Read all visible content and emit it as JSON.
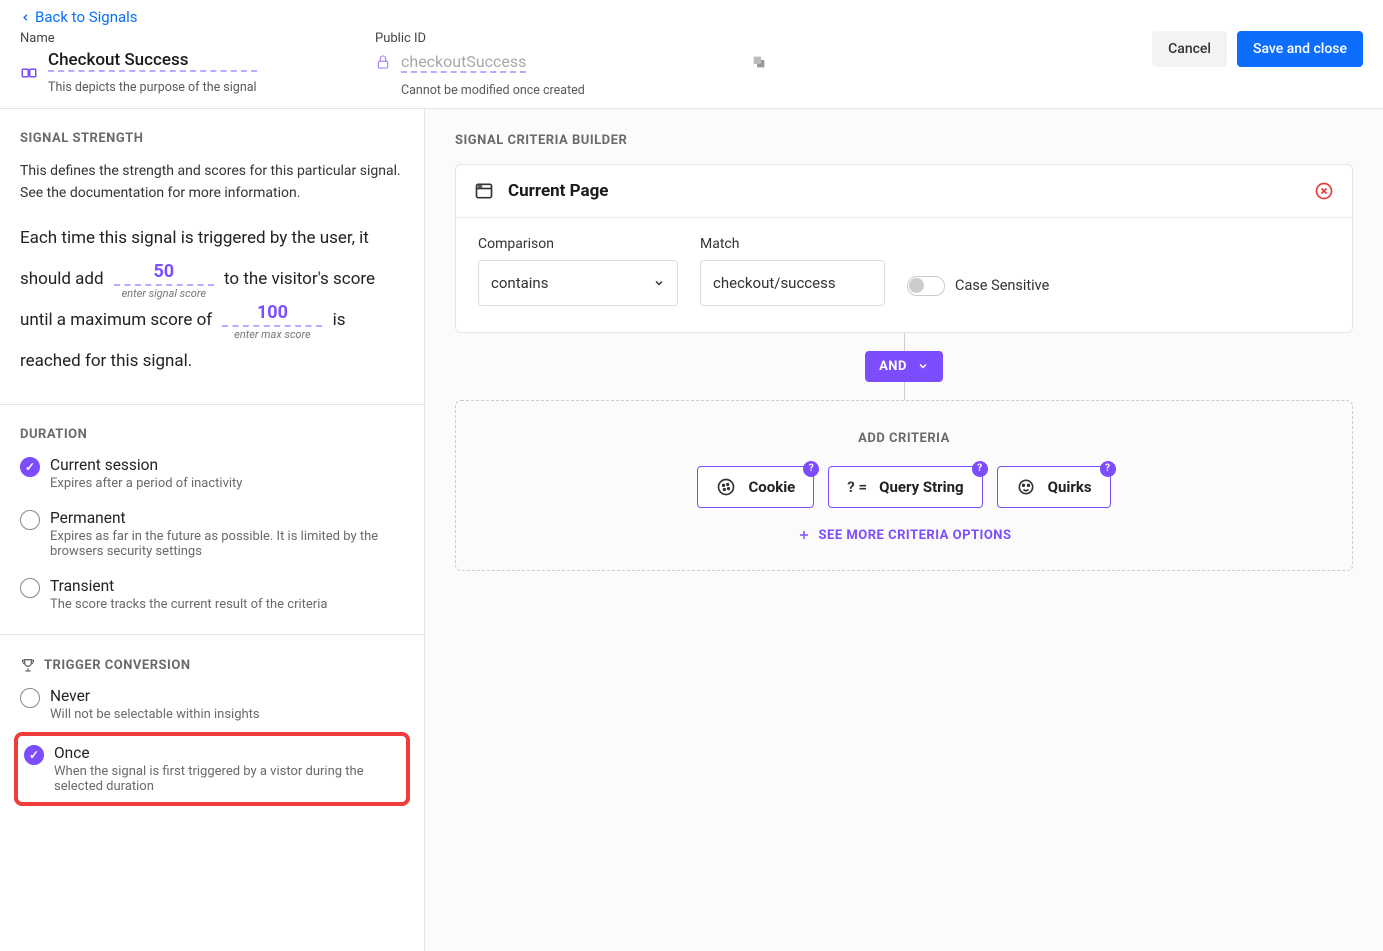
{
  "header": {
    "back_label": "Back to Signals",
    "name_label": "Name",
    "name_value": "Checkout Success",
    "name_helper": "This depicts the purpose of the signal",
    "publicid_label": "Public ID",
    "publicid_value": "checkoutSuccess",
    "publicid_helper": "Cannot be modified once created",
    "cancel_label": "Cancel",
    "save_label": "Save and close"
  },
  "strength": {
    "title": "SIGNAL STRENGTH",
    "desc": "This defines the strength and scores for this particular signal. See the documentation for more information.",
    "p1": "Each time this signal is triggered by the user, it should add",
    "score": "50",
    "score_hint": "enter signal score",
    "p2": "to the visitor's score until a maximum score of",
    "max_score": "100",
    "max_hint": "enter max score",
    "p3": "is reached for this signal."
  },
  "duration": {
    "title": "DURATION",
    "items": [
      {
        "label": "Current session",
        "sub": "Expires after a period of inactivity",
        "selected": true
      },
      {
        "label": "Permanent",
        "sub": "Expires as far in the future as possible. It is limited by the browsers security settings",
        "selected": false
      },
      {
        "label": "Transient",
        "sub": "The score tracks the current result of the criteria",
        "selected": false
      }
    ]
  },
  "trigger": {
    "title": "TRIGGER CONVERSION",
    "items": [
      {
        "label": "Never",
        "sub": "Will not be selectable within insights",
        "selected": false,
        "highlight": false
      },
      {
        "label": "Once",
        "sub": "When the signal is first triggered by a vistor during the selected duration",
        "selected": true,
        "highlight": true
      }
    ]
  },
  "builder": {
    "title": "SIGNAL CRITERIA BUILDER",
    "card_title": "Current Page",
    "comparison_label": "Comparison",
    "comparison_value": "contains",
    "match_label": "Match",
    "match_value": "checkout/success",
    "case_sensitive_label": "Case Sensitive",
    "and_label": "AND",
    "add_title": "ADD CRITERIA",
    "buttons": {
      "cookie": "Cookie",
      "query": "Query String",
      "quirks": "Quirks"
    },
    "see_more": "SEE MORE CRITERIA OPTIONS"
  }
}
